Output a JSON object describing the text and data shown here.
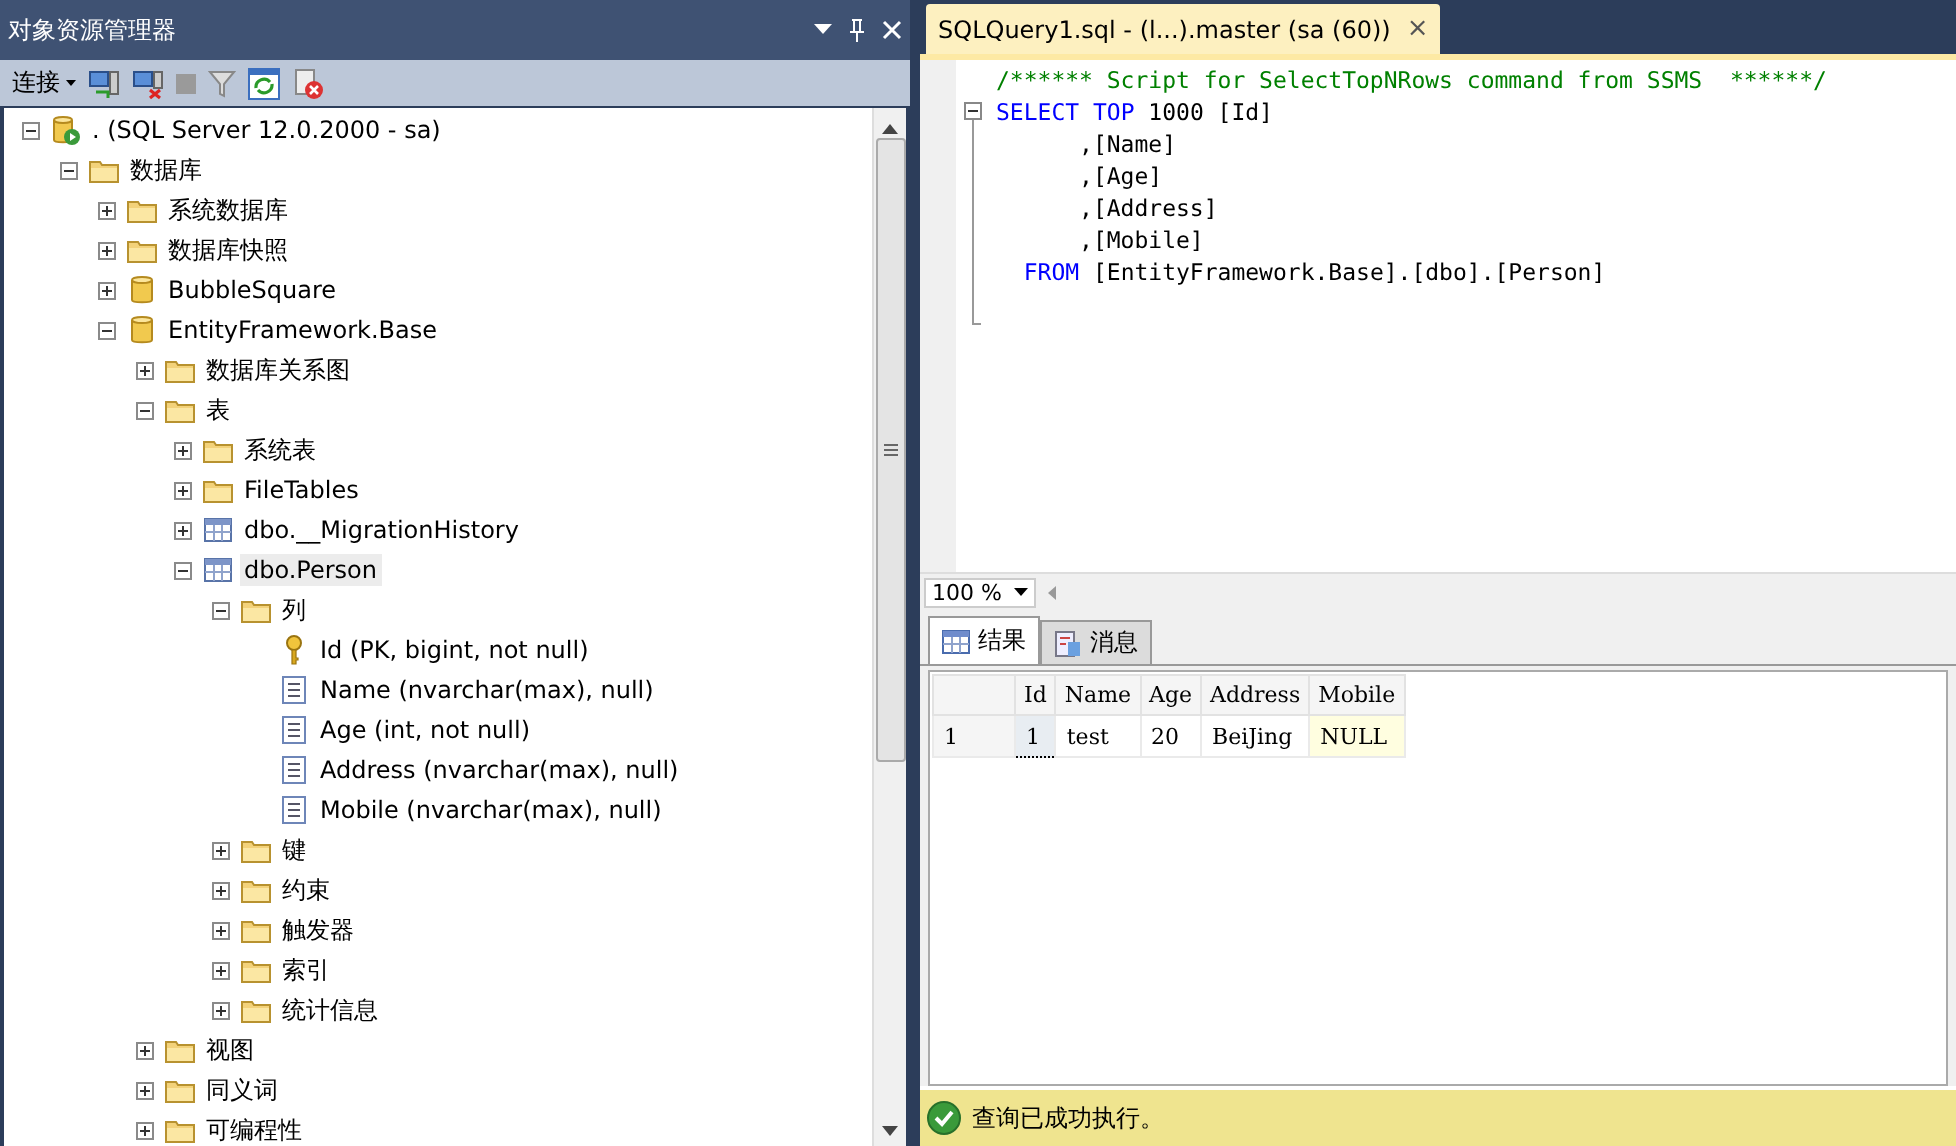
{
  "explorer": {
    "title": "对象资源管理器",
    "toolbar": {
      "connect_label": "连接"
    },
    "tree": [
      {
        "label": ". (SQL Server 12.0.2000 - sa)",
        "kind": "server",
        "expanded": true,
        "selected": false,
        "children": [
          {
            "label": "数据库",
            "kind": "folder",
            "expanded": true,
            "selected": false,
            "children": [
              {
                "label": "系统数据库",
                "kind": "folder",
                "expanded": false,
                "selected": false
              },
              {
                "label": "数据库快照",
                "kind": "folder",
                "expanded": false,
                "selected": false
              },
              {
                "label": "BubbleSquare",
                "kind": "database",
                "expanded": false,
                "selected": false
              },
              {
                "label": "EntityFramework.Base",
                "kind": "database",
                "expanded": true,
                "selected": false,
                "children": [
                  {
                    "label": "数据库关系图",
                    "kind": "folder",
                    "expanded": false,
                    "selected": false
                  },
                  {
                    "label": "表",
                    "kind": "folder",
                    "expanded": true,
                    "selected": false,
                    "children": [
                      {
                        "label": "系统表",
                        "kind": "folder",
                        "expanded": false,
                        "selected": false
                      },
                      {
                        "label": "FileTables",
                        "kind": "folder",
                        "expanded": false,
                        "selected": false
                      },
                      {
                        "label": "dbo.__MigrationHistory",
                        "kind": "table",
                        "expanded": false,
                        "selected": false
                      },
                      {
                        "label": "dbo.Person",
                        "kind": "table",
                        "expanded": true,
                        "selected": true,
                        "children": [
                          {
                            "label": "列",
                            "kind": "folder",
                            "expanded": true,
                            "selected": false,
                            "children": [
                              {
                                "label": "Id (PK, bigint, not null)",
                                "kind": "key",
                                "selected": false
                              },
                              {
                                "label": "Name (nvarchar(max), null)",
                                "kind": "column",
                                "selected": false
                              },
                              {
                                "label": "Age (int, not null)",
                                "kind": "column",
                                "selected": false
                              },
                              {
                                "label": "Address (nvarchar(max), null)",
                                "kind": "column",
                                "selected": false
                              },
                              {
                                "label": "Mobile (nvarchar(max), null)",
                                "kind": "column",
                                "selected": false
                              }
                            ]
                          },
                          {
                            "label": "键",
                            "kind": "folder",
                            "expanded": false,
                            "selected": false
                          },
                          {
                            "label": "约束",
                            "kind": "folder",
                            "expanded": false,
                            "selected": false
                          },
                          {
                            "label": "触发器",
                            "kind": "folder",
                            "expanded": false,
                            "selected": false
                          },
                          {
                            "label": "索引",
                            "kind": "folder",
                            "expanded": false,
                            "selected": false
                          },
                          {
                            "label": "统计信息",
                            "kind": "folder",
                            "expanded": false,
                            "selected": false
                          }
                        ]
                      }
                    ]
                  },
                  {
                    "label": "视图",
                    "kind": "folder",
                    "expanded": false,
                    "selected": false
                  },
                  {
                    "label": "同义词",
                    "kind": "folder",
                    "expanded": false,
                    "selected": false
                  },
                  {
                    "label": "可编程性",
                    "kind": "folder",
                    "expanded": false,
                    "selected": false
                  }
                ]
              }
            ]
          }
        ]
      }
    ]
  },
  "editor": {
    "tab": {
      "title": "SQLQuery1.sql - (l...).master (sa (60))",
      "close": "×"
    },
    "lines": [
      {
        "tokens": [
          {
            "text": "/****** Script for SelectTopNRows command from SSMS  ******/",
            "kind": "comment"
          }
        ]
      },
      {
        "tokens": [
          {
            "text": "SELECT",
            "kind": "keyword"
          },
          {
            "text": " TOP",
            "kind": "keyword"
          },
          {
            "text": " 1000 [Id]",
            "kind": "plain"
          }
        ]
      },
      {
        "tokens": [
          {
            "text": "      ,[Name]",
            "kind": "plain"
          }
        ]
      },
      {
        "tokens": [
          {
            "text": "      ,[Age]",
            "kind": "plain"
          }
        ]
      },
      {
        "tokens": [
          {
            "text": "      ,[Address]",
            "kind": "plain"
          }
        ]
      },
      {
        "tokens": [
          {
            "text": "      ,[Mobile]",
            "kind": "plain"
          }
        ]
      },
      {
        "tokens": [
          {
            "text": "  FROM",
            "kind": "keyword"
          },
          {
            "text": " [EntityFramework.Base].[dbo].[Person]",
            "kind": "plain"
          }
        ]
      }
    ],
    "zoom": "100 %"
  },
  "results": {
    "tabs": [
      {
        "label": "结果",
        "kind": "grid",
        "selected": true
      },
      {
        "label": "消息",
        "kind": "messages",
        "selected": false
      }
    ],
    "columns": [
      "Id",
      "Name",
      "Age",
      "Address",
      "Mobile"
    ],
    "rows": [
      {
        "number": "1",
        "cells": [
          {
            "text": "1",
            "kind": "value",
            "selected": true
          },
          {
            "text": "test",
            "kind": "value",
            "selected": false
          },
          {
            "text": "20",
            "kind": "value",
            "selected": false
          },
          {
            "text": "BeiJing",
            "kind": "value",
            "selected": false
          },
          {
            "text": "NULL",
            "kind": "null",
            "selected": false
          }
        ]
      }
    ]
  },
  "status_bar": {
    "message": "查询已成功执行。"
  }
}
